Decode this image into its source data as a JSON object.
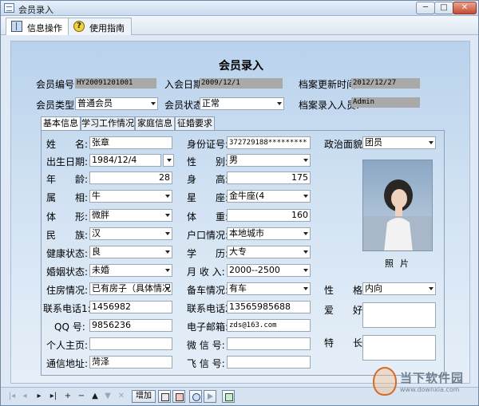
{
  "window": {
    "title": "会员录入",
    "min": "─",
    "max": "□",
    "close": "✕"
  },
  "toolbar": {
    "tab_info": "信息操作",
    "tab_help": "使用指南",
    "help_glyph": "?"
  },
  "form": {
    "title": "会员录入",
    "member_no_label": "会员编号:",
    "member_no": "HY20091201001",
    "join_date_label": "入会日期:",
    "join_date": "2009/12/1",
    "update_time_label": "档案更新时间:",
    "update_time": "2012/12/27",
    "member_type_label": "会员类型:",
    "member_type": "普通会员",
    "member_status_label": "会员状态:",
    "member_status": "正常",
    "entry_person_label": "档案录入人员:",
    "entry_person": "Admin"
  },
  "tabs": [
    "基本信息",
    "学习工作情况",
    "家庭信息",
    "征婚要求"
  ],
  "basic": {
    "name_label": "姓　　名:",
    "name": "张章",
    "idcard_label": "身份证号:",
    "idcard": "372729188*********",
    "politics_label": "政治面貌:",
    "politics": "团员",
    "birth_label": "出生日期:",
    "birth": "1984/12/4",
    "gender_label": "性　　别:",
    "gender": "男",
    "age_label": "年　　龄:",
    "age": "28",
    "height_label": "身　　高:",
    "height": "175",
    "zodiac_label": "属　　相:",
    "zodiac": "牛",
    "star_label": "星　　座:",
    "star": "金牛座(4",
    "body_label": "体　　形:",
    "body": "微胖",
    "weight_label": "体　　重:",
    "weight": "160",
    "nation_label": "民　　族:",
    "nation": "汉",
    "hukou_label": "户口情况:",
    "hukou": "本地城市",
    "health_label": "健康状态:",
    "health": "良",
    "edu_label": "学　　历:",
    "edu": "大专",
    "marriage_label": "婚姻状态:",
    "marriage": "未婚",
    "income_label": "月 收 入:",
    "income": "2000--2500",
    "house_label": "住房情况:",
    "house": "已有房子（具体情况",
    "car_label": "备车情况:",
    "car": "有车",
    "char_label": "性　　格:",
    "char": "内向",
    "phone1_label": "联系电话1:",
    "phone1": "1456982",
    "phone2_label": "联系电话2:",
    "phone2": "13565985688",
    "hobby_label": "爱　　好:",
    "qq_label": "QQ 号:",
    "qq": "9856236",
    "email_label": "电子邮箱:",
    "email": "zds@163.com",
    "homepage_label": "个人主页:",
    "wechat_label": "微 信 号:",
    "skill_label": "特　　长:",
    "address_label": "通信地址:",
    "address": "菏泽",
    "feixin_label": "飞 信 号:",
    "photo_label": "照片"
  },
  "navbar": {
    "first": "|◂",
    "prev": "◂",
    "next": "▸",
    "last": "▸|",
    "add_glyph": "+",
    "delete_glyph": "−",
    "up": "▲",
    "down": "▼",
    "cancel": "✕",
    "add_button": "增加"
  },
  "watermark": {
    "text": "当下软件园",
    "url": "www.downxia.com"
  },
  "colors": {
    "panel_top": "#b9d2ec",
    "readonly_gray": "#a9a9a9",
    "close_red": "#c64a32"
  }
}
